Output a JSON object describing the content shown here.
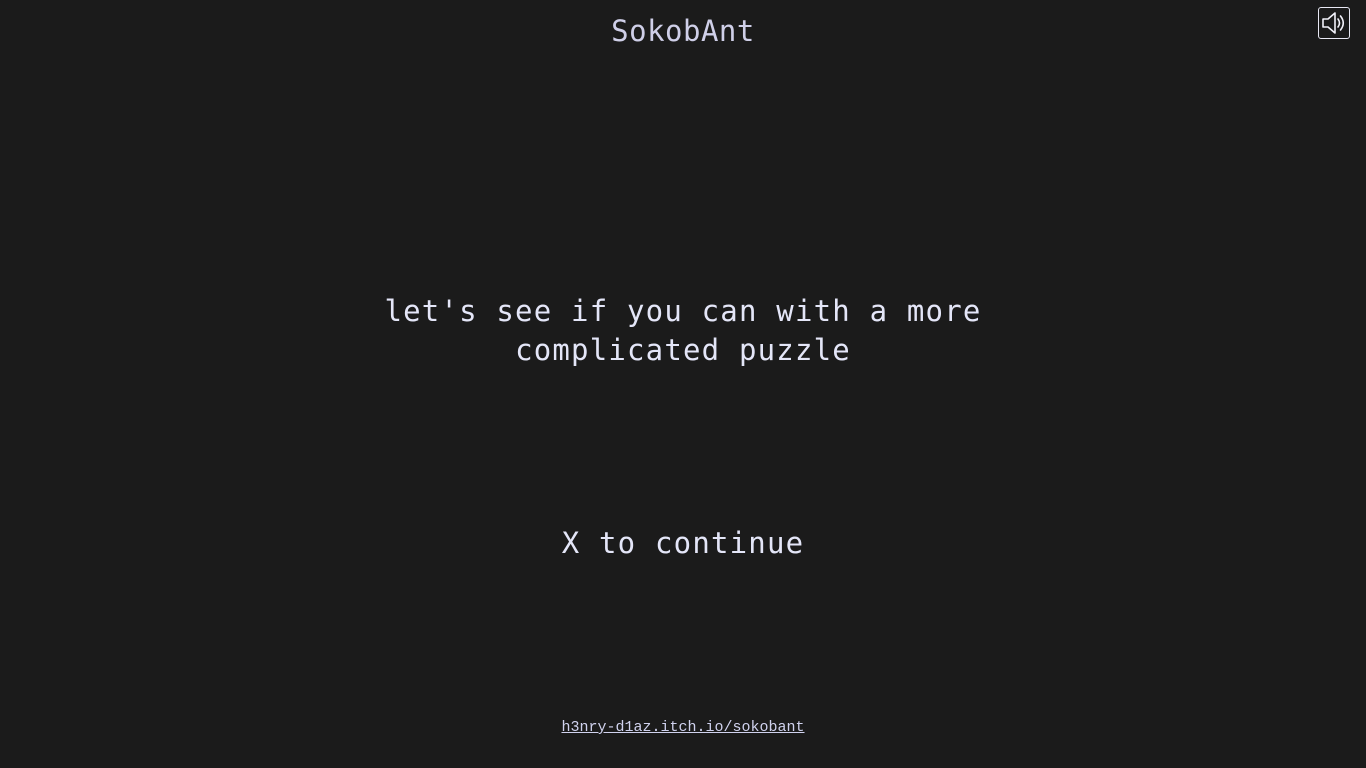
{
  "header": {
    "title": "SokobAnt"
  },
  "controls": {
    "sound_icon": "speaker-icon"
  },
  "game": {
    "message_line_1": "let's see if you can with a more",
    "message_line_2": "complicated puzzle",
    "continue_prompt": "X to continue"
  },
  "footer": {
    "link_text": "h3nry-d1az.itch.io/sokobant"
  },
  "colors": {
    "background": "#1b1b1b",
    "text": "#e4e6f8",
    "title": "#cfcfe8"
  }
}
